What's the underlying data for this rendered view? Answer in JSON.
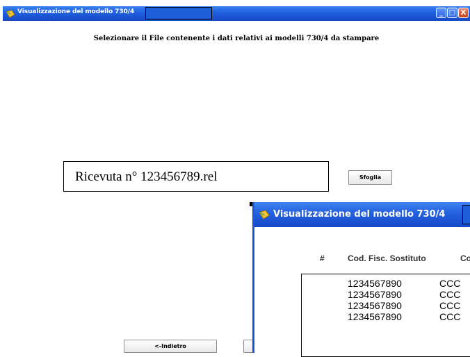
{
  "main_window": {
    "title": "Visualizzazione del modello 730/4",
    "instruction": "Selezionare il File contenente i dati relativi ai modelli 730/4 da stampare",
    "file_name": "Ricevuta  n°  123456789.rel",
    "browse_label": "Sfoglia",
    "back_label": "<-Indietro",
    "controls": {
      "minimize": "_",
      "maximize": "□",
      "close": "X"
    }
  },
  "second_window": {
    "title": "Visualizzazione del modello 730/4",
    "columns": [
      "#",
      "Cod. Fisc. Sostituto",
      "Co"
    ],
    "rows": [
      {
        "num": "",
        "cf": "1234567890",
        "c3": "CCC"
      },
      {
        "num": "",
        "cf": "1234567890",
        "c3": "CCC"
      },
      {
        "num": "",
        "cf": "1234567890",
        "c3": "CCC"
      },
      {
        "num": "",
        "cf": "1234567890",
        "c3": "CCC"
      }
    ]
  },
  "colors": {
    "titlebar": "#1f5fde",
    "close_button": "#c3431c",
    "window_bg": "#ffffff"
  },
  "icons": [
    "app-icon",
    "minimize-icon",
    "maximize-icon",
    "close-icon"
  ]
}
